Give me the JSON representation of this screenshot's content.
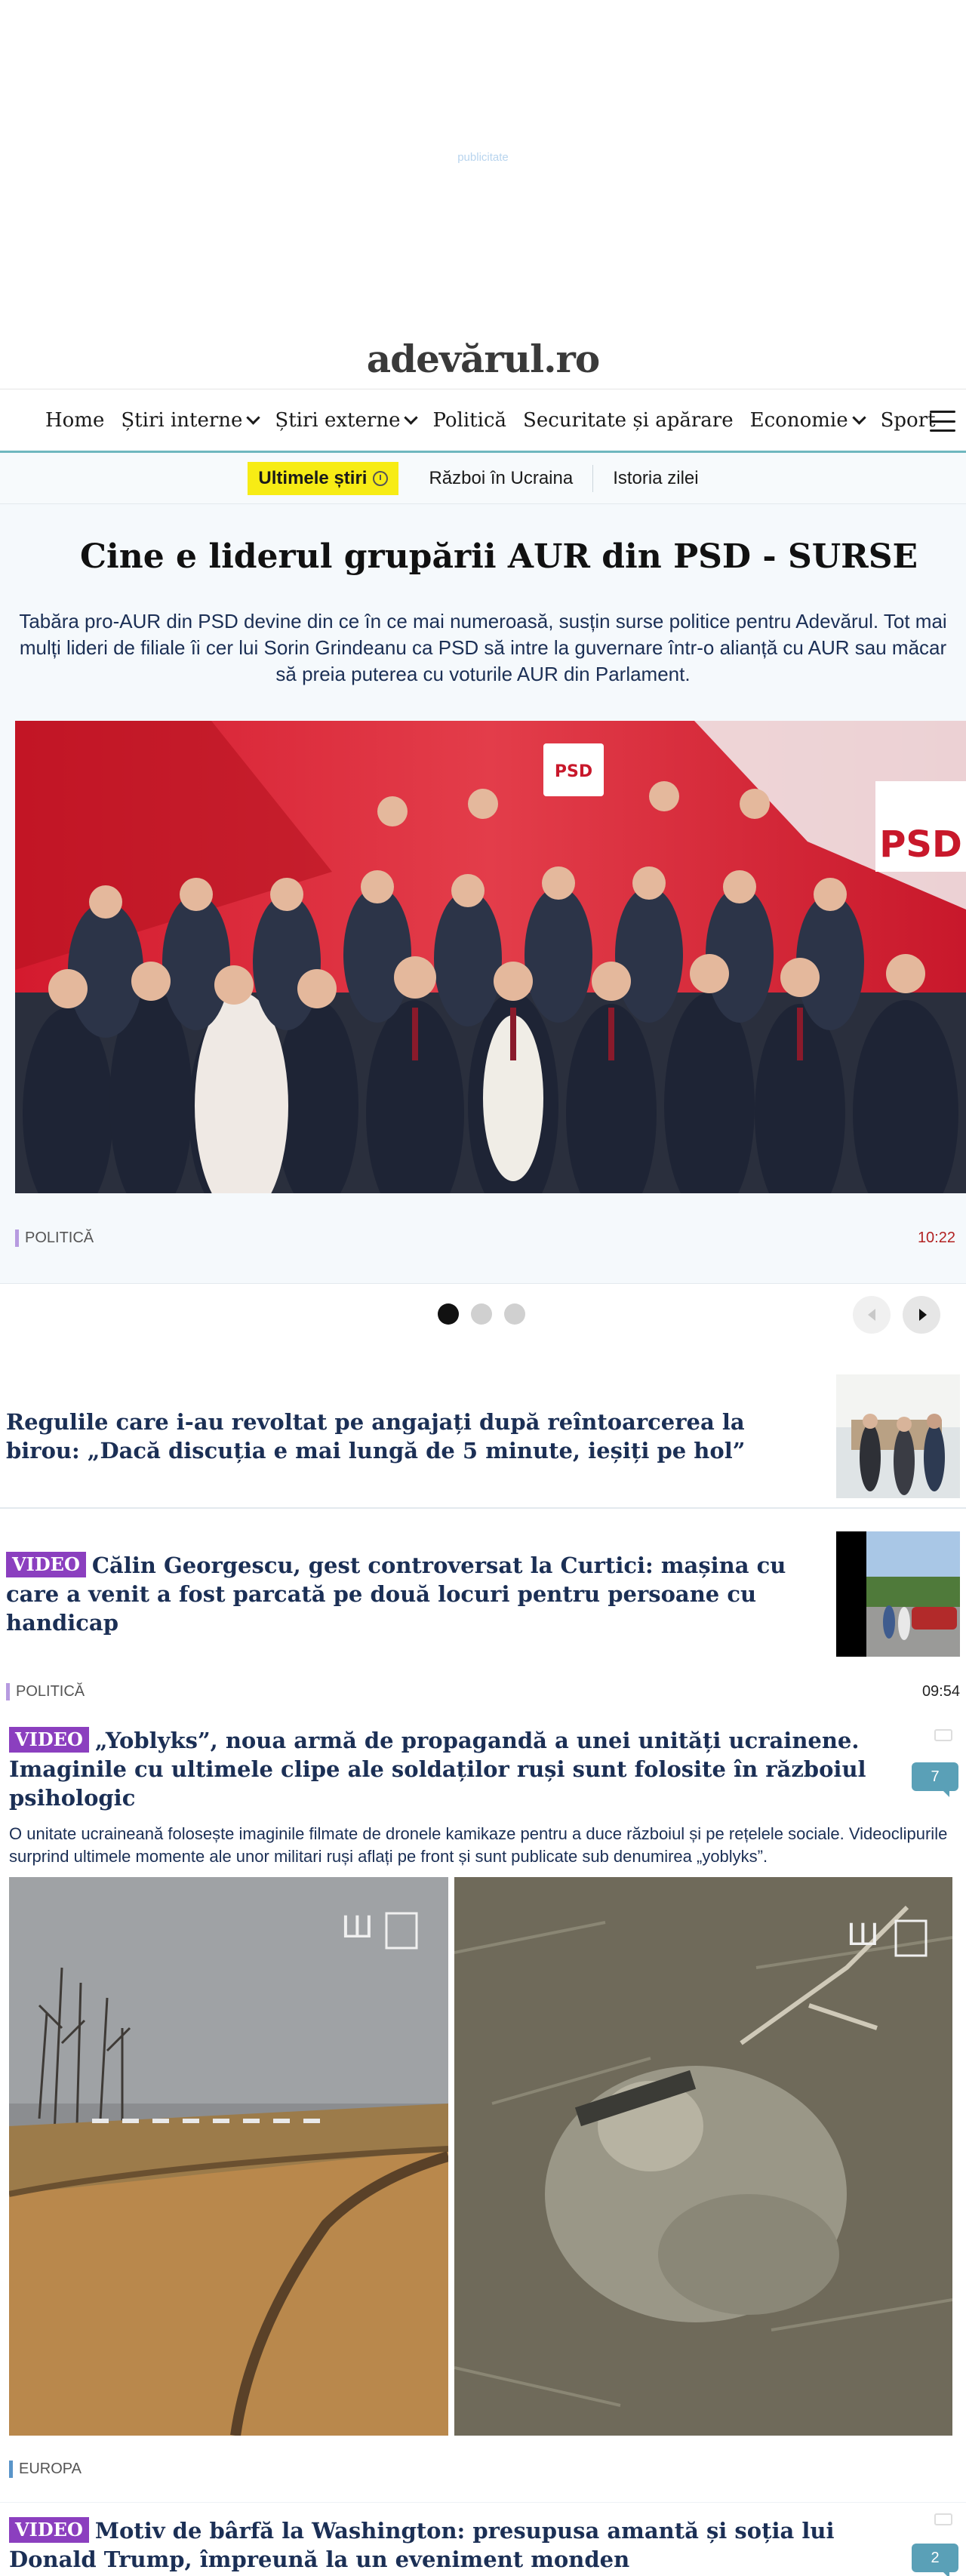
{
  "ad": {
    "label": "publicitate"
  },
  "site": {
    "logo": "adevărul.ro"
  },
  "nav": {
    "items": [
      "Home",
      "Știri interne",
      "Știri externe",
      "Politică",
      "Securitate și apărare",
      "Economie",
      "Sport"
    ]
  },
  "subnav": {
    "latest": "Ultimele știri",
    "items": [
      "Război în Ucraina",
      "Istoria zilei"
    ]
  },
  "hero": {
    "title": "Cine e liderul grupării AUR din PSD - SURSE",
    "description": "Tabăra pro-AUR din PSD devine din ce în ce mai numeroasă, susțin surse politice pentru Adevărul. Tot mai mulți lideri de filiale îi cer lui Sorin Grindeanu ca PSD să intre la guvernare într-o alianță cu AUR sau măcar să preia puterea cu voturile AUR din Parlament.",
    "category": "POLITICĂ",
    "time": "10:22",
    "image_text": "PSD"
  },
  "carousel": {
    "slides": 3,
    "active": 0
  },
  "stories": [
    {
      "title": "Regulile care i-au revoltat pe angajați după reîntoarcerea la birou: „Dacă discuția e mai lungă de 5 minute, ieșiți pe hol”"
    },
    {
      "badge": "VIDEO",
      "title": "Călin Georgescu, gest controversat la Curtici: mașina cu care a venit a fost parcată pe două locuri pentru persoane cu handicap",
      "category": "POLITICĂ",
      "time": "09:54"
    }
  ],
  "featured": {
    "badge": "VIDEO",
    "title": "„Yoblyks”, noua armă de propagandă a unei unități ucrainene. Imaginile cu ultimele clipe ale soldaților ruși sunt folosite în războiul psihologic",
    "description": "O unitate ucraineană folosește imaginile filmate de dronele kamikaze pentru a duce războiul și pe rețelele sociale. Videoclipurile surprind ultimele momente ale unor militari ruși aflați pe front și sunt publicate sub denumirea „yoblyks”.",
    "comments": "7",
    "category": "EUROPA"
  },
  "last": {
    "badge": "VIDEO",
    "title": "Motiv de bârfă la Washington: presupusa amantă și soția lui Donald Trump, împreună la un eveniment monden",
    "comments": "2"
  },
  "colors": {
    "accent": "#6fb7bf",
    "video_badge": "#8b3fbf",
    "latest_pill": "#f7ec15",
    "hero_bg": "#c8182b"
  }
}
